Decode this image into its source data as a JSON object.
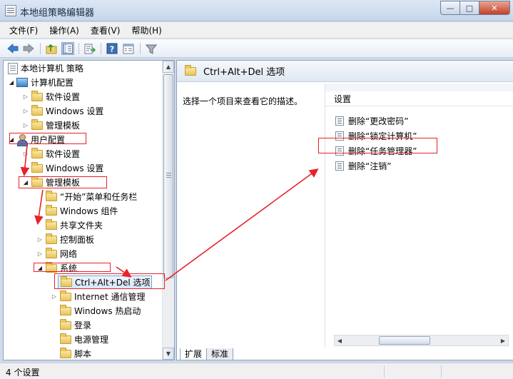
{
  "window": {
    "title": "本地组策略编辑器",
    "controls": {
      "minimize": "—",
      "maximize": "□",
      "close": "✕"
    }
  },
  "menu": [
    "文件(F)",
    "操作(A)",
    "查看(V)",
    "帮助(H)"
  ],
  "toolbar": [
    "back-arrow-icon",
    "forward-arrow-icon",
    "up-folder-icon",
    "show-hide-tree-icon",
    "export-list-icon",
    "help-icon",
    "properties-icon",
    "filter-icon"
  ],
  "tree": {
    "root": "本地计算机 策略",
    "computer": "计算机配置",
    "computer_children": [
      "软件设置",
      "Windows 设置",
      "管理模板"
    ],
    "user": "用户配置",
    "user_children": [
      "软件设置",
      "Windows 设置",
      "管理模板"
    ],
    "admin_children": [
      "“开始”菜单和任务栏",
      "Windows 组件",
      "共享文件夹",
      "控制面板",
      "网络",
      "系统"
    ],
    "system_children": [
      "Ctrl+Alt+Del 选项",
      "Internet 通信管理",
      "Windows 热启动",
      "登录",
      "电源管理",
      "脚本"
    ]
  },
  "right": {
    "header": "Ctrl+Alt+Del 选项",
    "description": "选择一个项目来查看它的描述。",
    "settings_label": "设置",
    "settings": [
      "删除“更改密码”",
      "删除“锁定计算机”",
      "删除“任务管理器”",
      "删除“注销”"
    ]
  },
  "tabs": [
    "扩展",
    "标准"
  ],
  "status": "4 个设置",
  "annotation_color": "#e8222a"
}
